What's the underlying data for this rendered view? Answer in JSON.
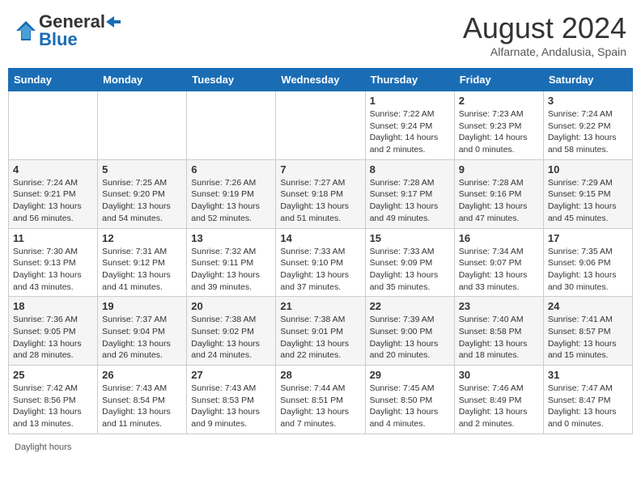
{
  "header": {
    "logo_line1": "General",
    "logo_line2": "Blue",
    "month_title": "August 2024",
    "subtitle": "Alfarnate, Andalusia, Spain"
  },
  "days_of_week": [
    "Sunday",
    "Monday",
    "Tuesday",
    "Wednesday",
    "Thursday",
    "Friday",
    "Saturday"
  ],
  "weeks": [
    [
      {
        "day": "",
        "info": ""
      },
      {
        "day": "",
        "info": ""
      },
      {
        "day": "",
        "info": ""
      },
      {
        "day": "",
        "info": ""
      },
      {
        "day": "1",
        "info": "Sunrise: 7:22 AM\nSunset: 9:24 PM\nDaylight: 14 hours and 2 minutes."
      },
      {
        "day": "2",
        "info": "Sunrise: 7:23 AM\nSunset: 9:23 PM\nDaylight: 14 hours and 0 minutes."
      },
      {
        "day": "3",
        "info": "Sunrise: 7:24 AM\nSunset: 9:22 PM\nDaylight: 13 hours and 58 minutes."
      }
    ],
    [
      {
        "day": "4",
        "info": "Sunrise: 7:24 AM\nSunset: 9:21 PM\nDaylight: 13 hours and 56 minutes."
      },
      {
        "day": "5",
        "info": "Sunrise: 7:25 AM\nSunset: 9:20 PM\nDaylight: 13 hours and 54 minutes."
      },
      {
        "day": "6",
        "info": "Sunrise: 7:26 AM\nSunset: 9:19 PM\nDaylight: 13 hours and 52 minutes."
      },
      {
        "day": "7",
        "info": "Sunrise: 7:27 AM\nSunset: 9:18 PM\nDaylight: 13 hours and 51 minutes."
      },
      {
        "day": "8",
        "info": "Sunrise: 7:28 AM\nSunset: 9:17 PM\nDaylight: 13 hours and 49 minutes."
      },
      {
        "day": "9",
        "info": "Sunrise: 7:28 AM\nSunset: 9:16 PM\nDaylight: 13 hours and 47 minutes."
      },
      {
        "day": "10",
        "info": "Sunrise: 7:29 AM\nSunset: 9:15 PM\nDaylight: 13 hours and 45 minutes."
      }
    ],
    [
      {
        "day": "11",
        "info": "Sunrise: 7:30 AM\nSunset: 9:13 PM\nDaylight: 13 hours and 43 minutes."
      },
      {
        "day": "12",
        "info": "Sunrise: 7:31 AM\nSunset: 9:12 PM\nDaylight: 13 hours and 41 minutes."
      },
      {
        "day": "13",
        "info": "Sunrise: 7:32 AM\nSunset: 9:11 PM\nDaylight: 13 hours and 39 minutes."
      },
      {
        "day": "14",
        "info": "Sunrise: 7:33 AM\nSunset: 9:10 PM\nDaylight: 13 hours and 37 minutes."
      },
      {
        "day": "15",
        "info": "Sunrise: 7:33 AM\nSunset: 9:09 PM\nDaylight: 13 hours and 35 minutes."
      },
      {
        "day": "16",
        "info": "Sunrise: 7:34 AM\nSunset: 9:07 PM\nDaylight: 13 hours and 33 minutes."
      },
      {
        "day": "17",
        "info": "Sunrise: 7:35 AM\nSunset: 9:06 PM\nDaylight: 13 hours and 30 minutes."
      }
    ],
    [
      {
        "day": "18",
        "info": "Sunrise: 7:36 AM\nSunset: 9:05 PM\nDaylight: 13 hours and 28 minutes."
      },
      {
        "day": "19",
        "info": "Sunrise: 7:37 AM\nSunset: 9:04 PM\nDaylight: 13 hours and 26 minutes."
      },
      {
        "day": "20",
        "info": "Sunrise: 7:38 AM\nSunset: 9:02 PM\nDaylight: 13 hours and 24 minutes."
      },
      {
        "day": "21",
        "info": "Sunrise: 7:38 AM\nSunset: 9:01 PM\nDaylight: 13 hours and 22 minutes."
      },
      {
        "day": "22",
        "info": "Sunrise: 7:39 AM\nSunset: 9:00 PM\nDaylight: 13 hours and 20 minutes."
      },
      {
        "day": "23",
        "info": "Sunrise: 7:40 AM\nSunset: 8:58 PM\nDaylight: 13 hours and 18 minutes."
      },
      {
        "day": "24",
        "info": "Sunrise: 7:41 AM\nSunset: 8:57 PM\nDaylight: 13 hours and 15 minutes."
      }
    ],
    [
      {
        "day": "25",
        "info": "Sunrise: 7:42 AM\nSunset: 8:56 PM\nDaylight: 13 hours and 13 minutes."
      },
      {
        "day": "26",
        "info": "Sunrise: 7:43 AM\nSunset: 8:54 PM\nDaylight: 13 hours and 11 minutes."
      },
      {
        "day": "27",
        "info": "Sunrise: 7:43 AM\nSunset: 8:53 PM\nDaylight: 13 hours and 9 minutes."
      },
      {
        "day": "28",
        "info": "Sunrise: 7:44 AM\nSunset: 8:51 PM\nDaylight: 13 hours and 7 minutes."
      },
      {
        "day": "29",
        "info": "Sunrise: 7:45 AM\nSunset: 8:50 PM\nDaylight: 13 hours and 4 minutes."
      },
      {
        "day": "30",
        "info": "Sunrise: 7:46 AM\nSunset: 8:49 PM\nDaylight: 13 hours and 2 minutes."
      },
      {
        "day": "31",
        "info": "Sunrise: 7:47 AM\nSunset: 8:47 PM\nDaylight: 13 hours and 0 minutes."
      }
    ]
  ],
  "footer": {
    "daylight_label": "Daylight hours"
  }
}
